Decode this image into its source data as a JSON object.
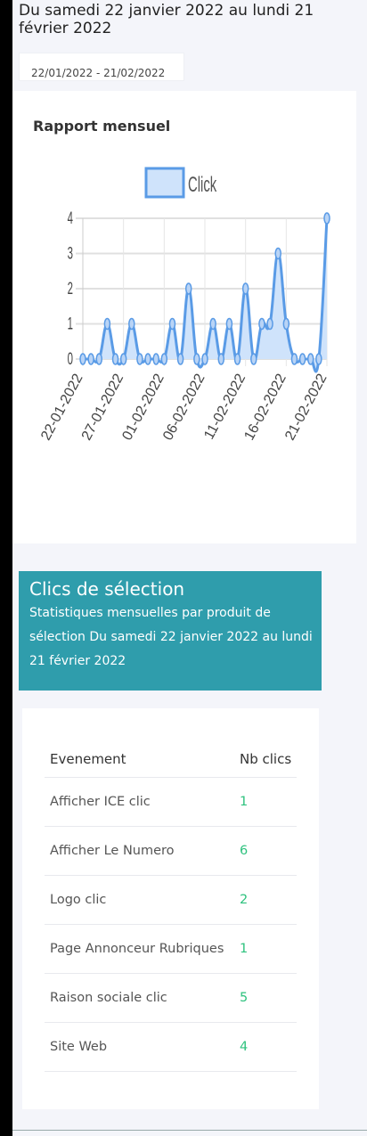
{
  "header": {
    "range_title": "Du samedi 22 janvier 2022 au lundi 21 février 2022",
    "date_input_value": "22/01/2022 - 21/02/2022"
  },
  "chart_card": {
    "title": "Rapport mensuel"
  },
  "chart_data": {
    "type": "area",
    "legend_label": "Click",
    "legend_position": "top",
    "ylim": [
      0,
      4
    ],
    "yticks": [
      "0",
      "1",
      "2",
      "3",
      "4"
    ],
    "xtick_labels": [
      "22-01-2022",
      "27-01-2022",
      "01-02-2022",
      "06-02-2022",
      "11-02-2022",
      "16-02-2022",
      "21-02-2022"
    ],
    "grid": true,
    "color": "#5a9be6",
    "fill_color": "#cfe3fb",
    "series": [
      {
        "x": [
          "22-01-2022",
          "23-01-2022",
          "24-01-2022",
          "25-01-2022",
          "26-01-2022",
          "27-01-2022",
          "28-01-2022",
          "29-01-2022",
          "30-01-2022",
          "31-01-2022",
          "01-02-2022",
          "02-02-2022",
          "03-02-2022",
          "04-02-2022",
          "05-02-2022",
          "06-02-2022",
          "07-02-2022",
          "08-02-2022",
          "09-02-2022",
          "10-02-2022",
          "11-02-2022",
          "12-02-2022",
          "13-02-2022",
          "14-02-2022",
          "15-02-2022",
          "16-02-2022",
          "17-02-2022",
          "18-02-2022",
          "19-02-2022",
          "20-02-2022",
          "21-02-2022"
        ],
        "values": [
          0,
          0,
          0,
          1,
          0,
          0,
          1,
          0,
          0,
          0,
          0,
          1,
          0,
          2,
          0,
          0,
          1,
          0,
          1,
          0,
          2,
          0,
          1,
          1,
          3,
          1,
          0,
          0,
          0,
          0,
          4
        ]
      }
    ]
  },
  "selection_card": {
    "title": "Clics de sélection",
    "subtitle": "Statistiques mensuelles par produit de sélection Du samedi 22 janvier 2022 au lundi 21 février 2022"
  },
  "table": {
    "headers": [
      "Evenement",
      "Nb clics"
    ],
    "rows": [
      {
        "event": "Afficher ICE clic",
        "clicks": "1"
      },
      {
        "event": "Afficher Le Numero",
        "clicks": "6"
      },
      {
        "event": "Logo clic",
        "clicks": "2"
      },
      {
        "event": "Page Annonceur Rubriques",
        "clicks": "1"
      },
      {
        "event": "Raison sociale clic",
        "clicks": "5"
      },
      {
        "event": "Site Web",
        "clicks": "4"
      }
    ]
  }
}
